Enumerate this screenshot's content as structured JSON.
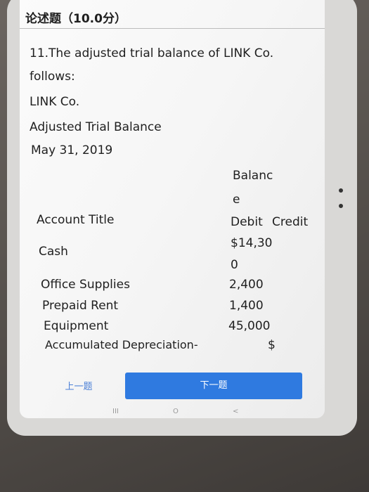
{
  "question": {
    "header": "论述题（10.0分）",
    "line1": "11.The adjusted trial balance of LINK Co.",
    "line2": "follows:",
    "company": "LINK  Co.",
    "subtitle": "Adjusted  Trial Balance",
    "date": "May  31,  2019"
  },
  "table": {
    "col_balance_1": "Balanc",
    "col_balance_2": "e",
    "col_account": "Account Title",
    "col_debit": "Debit",
    "col_credit": "Credit",
    "rows": [
      {
        "account": "Cash",
        "debit_1": "$14,30",
        "debit_2": "0"
      },
      {
        "account": "Office Supplies",
        "debit": "2,400"
      },
      {
        "account": "Prepaid Rent",
        "debit": "1,400"
      },
      {
        "account": "Equipment",
        "debit": "45,000"
      },
      {
        "account": "Accumulated Depreciation-",
        "credit": "$"
      }
    ]
  },
  "nav": {
    "prev_label": "上一题",
    "next_label": "下一题"
  },
  "navbar": {
    "recent": "III",
    "home": "O",
    "back": "<"
  },
  "colors": {
    "accent": "#2f7ae0"
  }
}
